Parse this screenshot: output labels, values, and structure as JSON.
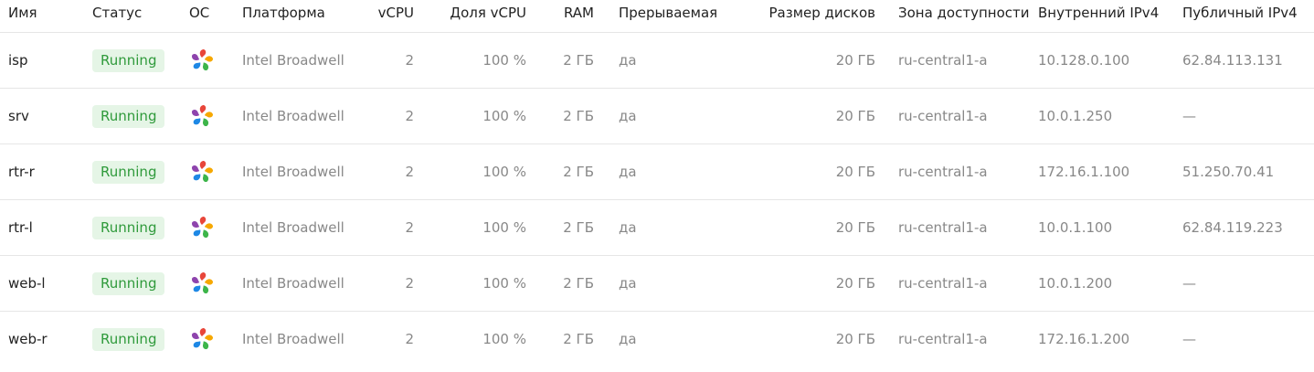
{
  "table": {
    "headers": {
      "name": "Имя",
      "status": "Статус",
      "os": "ОС",
      "platform": "Платформа",
      "vcpu": "vCPU",
      "vcpu_share": "Доля vCPU",
      "ram": "RAM",
      "preemptible": "Прерываемая",
      "disk_size": "Размер дисков",
      "zone": "Зона доступности",
      "internal_ipv4": "Внутренний IPv4",
      "public_ipv4": "Публичный IPv4"
    },
    "rows": [
      {
        "name": "isp",
        "status": "Running",
        "os_icon": "os-logo-icon",
        "platform": "Intel Broadwell",
        "vcpu": "2",
        "vcpu_share": "100 %",
        "ram": "2 ГБ",
        "preemptible": "да",
        "disk_size": "20 ГБ",
        "zone": "ru-central1-a",
        "internal_ipv4": "10.128.0.100",
        "public_ipv4": "62.84.113.131"
      },
      {
        "name": "srv",
        "status": "Running",
        "os_icon": "os-logo-icon",
        "platform": "Intel Broadwell",
        "vcpu": "2",
        "vcpu_share": "100 %",
        "ram": "2 ГБ",
        "preemptible": "да",
        "disk_size": "20 ГБ",
        "zone": "ru-central1-a",
        "internal_ipv4": "10.0.1.250",
        "public_ipv4": "—"
      },
      {
        "name": "rtr-r",
        "status": "Running",
        "os_icon": "os-logo-icon",
        "platform": "Intel Broadwell",
        "vcpu": "2",
        "vcpu_share": "100 %",
        "ram": "2 ГБ",
        "preemptible": "да",
        "disk_size": "20 ГБ",
        "zone": "ru-central1-a",
        "internal_ipv4": "172.16.1.100",
        "public_ipv4": "51.250.70.41"
      },
      {
        "name": "rtr-l",
        "status": "Running",
        "os_icon": "os-logo-icon",
        "platform": "Intel Broadwell",
        "vcpu": "2",
        "vcpu_share": "100 %",
        "ram": "2 ГБ",
        "preemptible": "да",
        "disk_size": "20 ГБ",
        "zone": "ru-central1-a",
        "internal_ipv4": "10.0.1.100",
        "public_ipv4": "62.84.119.223"
      },
      {
        "name": "web-l",
        "status": "Running",
        "os_icon": "os-logo-icon",
        "platform": "Intel Broadwell",
        "vcpu": "2",
        "vcpu_share": "100 %",
        "ram": "2 ГБ",
        "preemptible": "да",
        "disk_size": "20 ГБ",
        "zone": "ru-central1-a",
        "internal_ipv4": "10.0.1.200",
        "public_ipv4": "—"
      },
      {
        "name": "web-r",
        "status": "Running",
        "os_icon": "os-logo-icon",
        "platform": "Intel Broadwell",
        "vcpu": "2",
        "vcpu_share": "100 %",
        "ram": "2 ГБ",
        "preemptible": "да",
        "disk_size": "20 ГБ",
        "zone": "ru-central1-a",
        "internal_ipv4": "172.16.1.200",
        "public_ipv4": "—"
      }
    ]
  },
  "colors": {
    "status_running_bg": "#e5f5e6",
    "status_running_text": "#2f9a3b",
    "os_logo": [
      "#e8463a",
      "#f6a800",
      "#3db54a",
      "#1e88e5",
      "#8e44ad"
    ]
  }
}
